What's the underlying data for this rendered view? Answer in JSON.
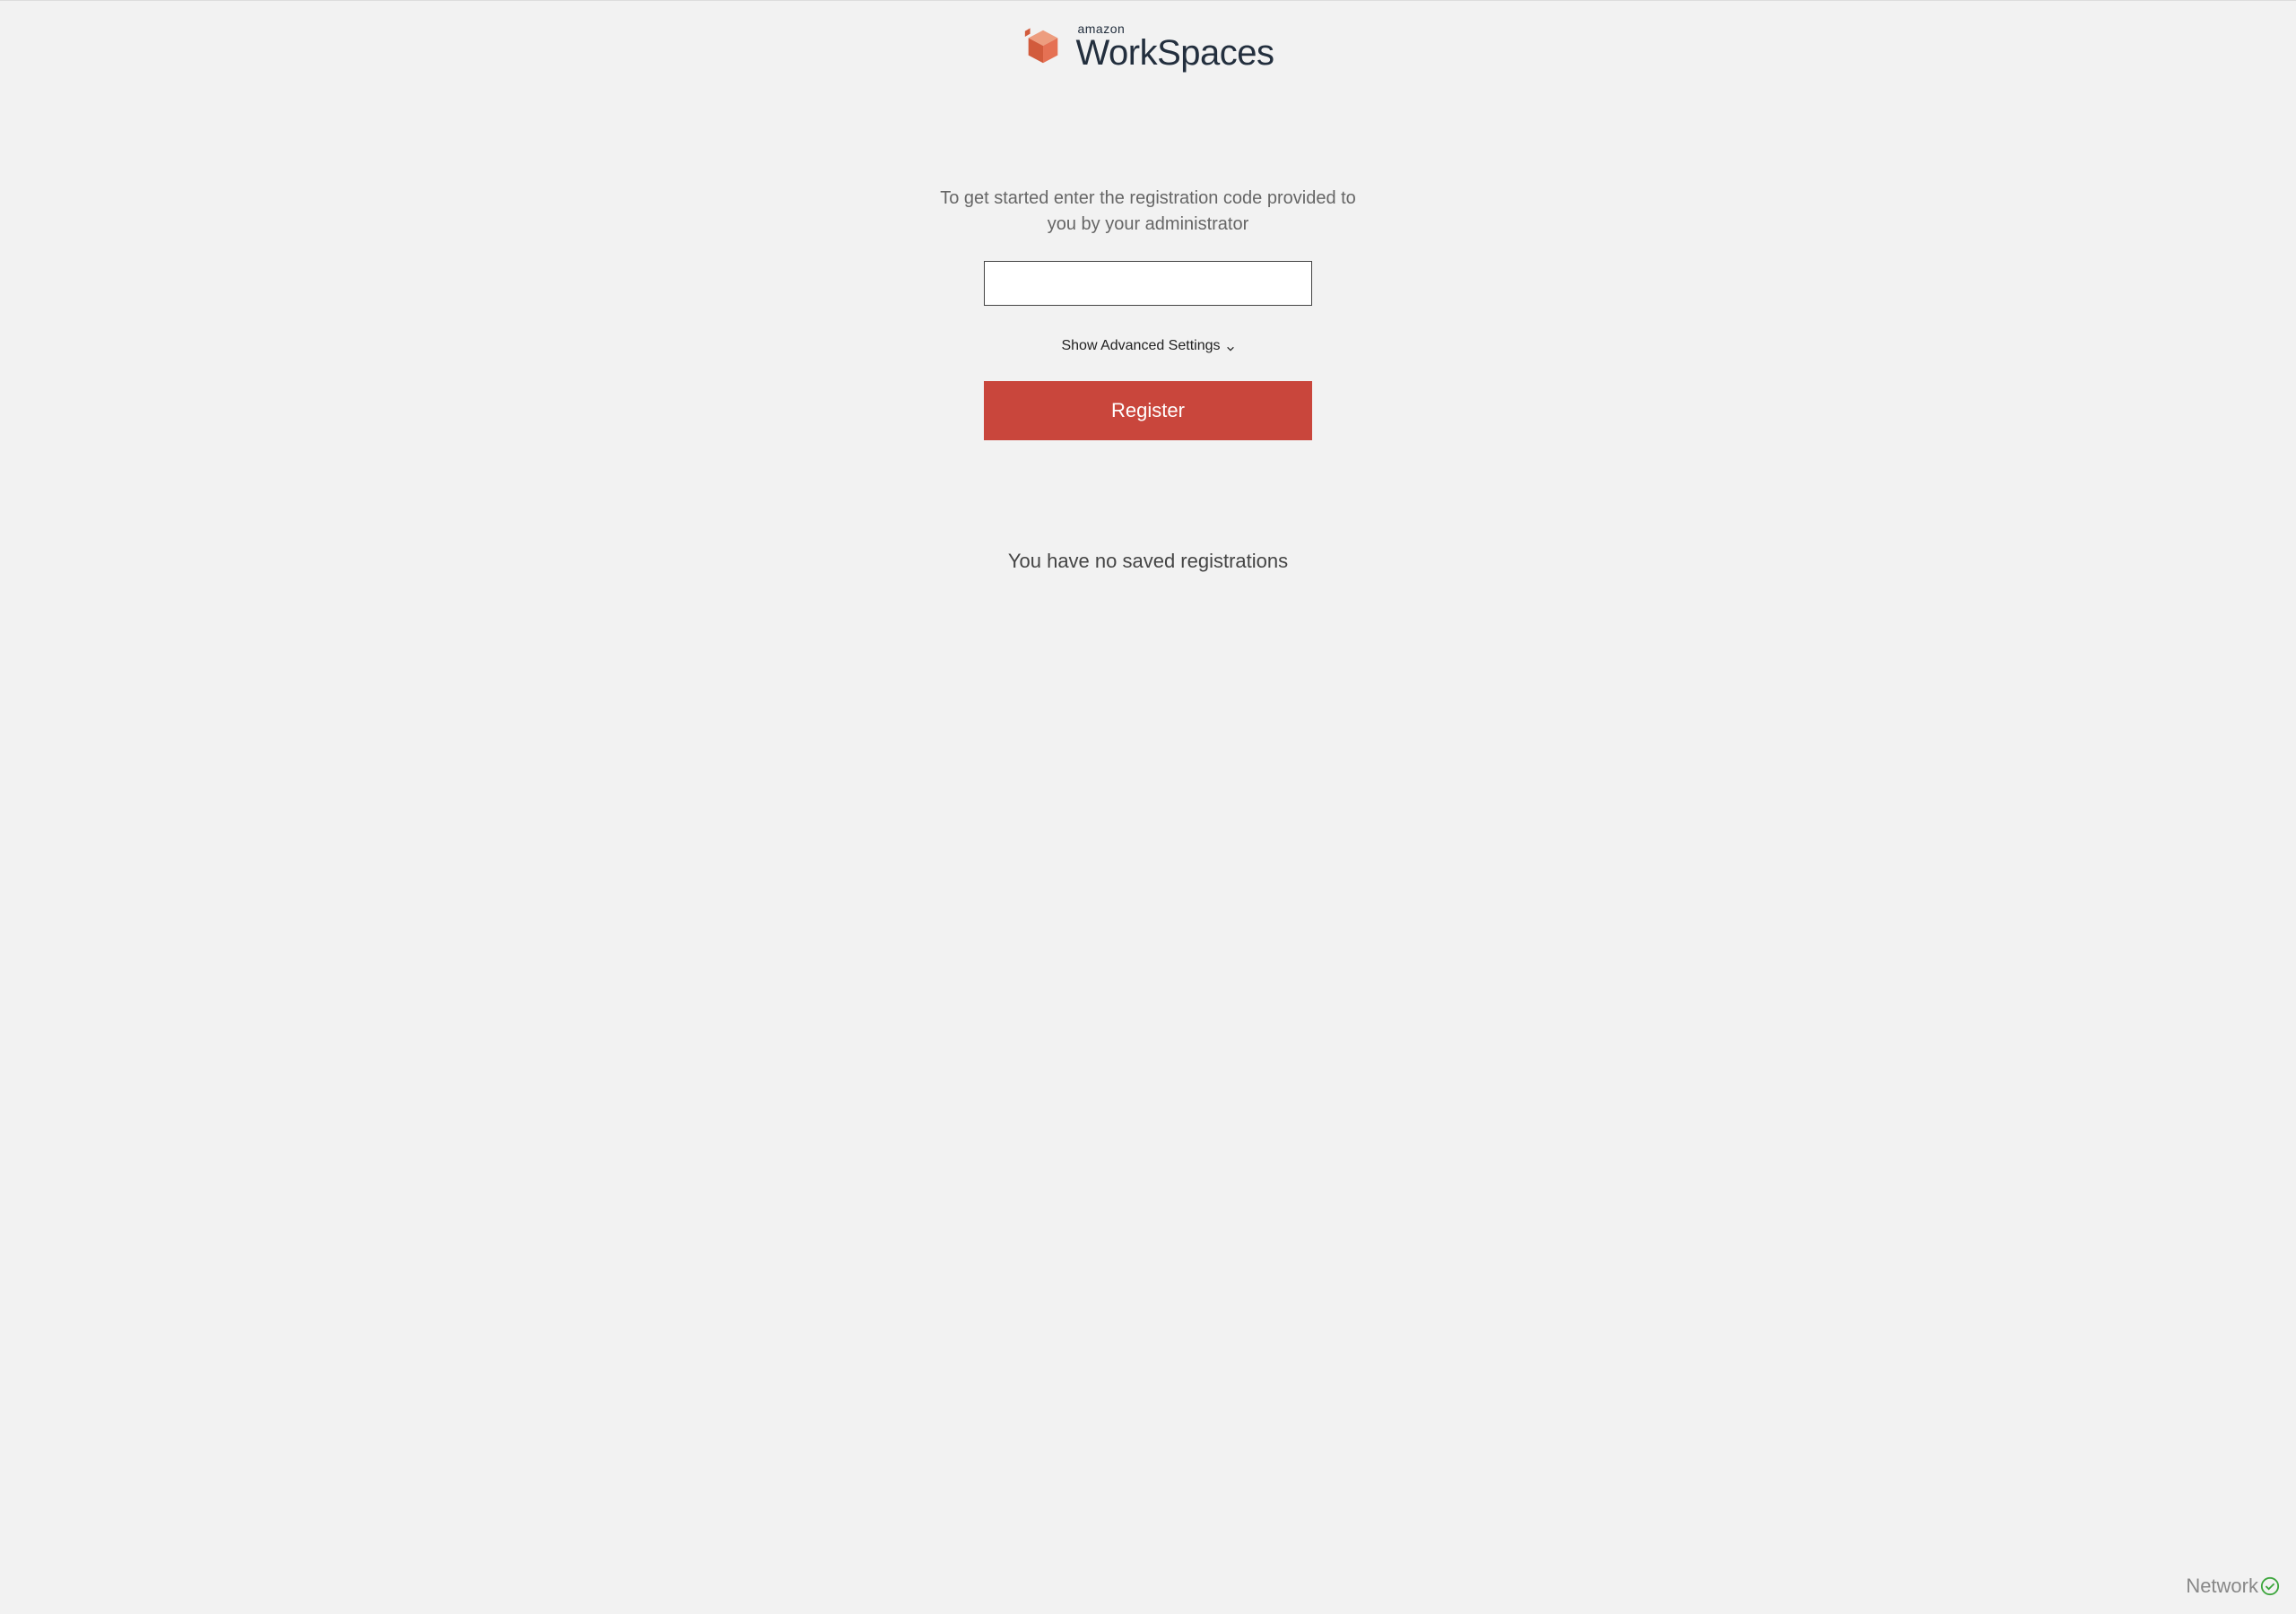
{
  "logo": {
    "small_text": "amazon",
    "large_text": "WorkSpaces"
  },
  "instruction": "To get started enter the registration code provided to you by your administrator",
  "registration_input": {
    "value": "",
    "placeholder": ""
  },
  "advanced_toggle_label": "Show Advanced Settings",
  "register_button_label": "Register",
  "no_saved_message": "You have no saved registrations",
  "network_status_label": "Network",
  "colors": {
    "brand_orange": "#e57154",
    "brand_orange_dark": "#d25b3c",
    "button_red": "#c9463c",
    "status_green": "#3da63d"
  }
}
